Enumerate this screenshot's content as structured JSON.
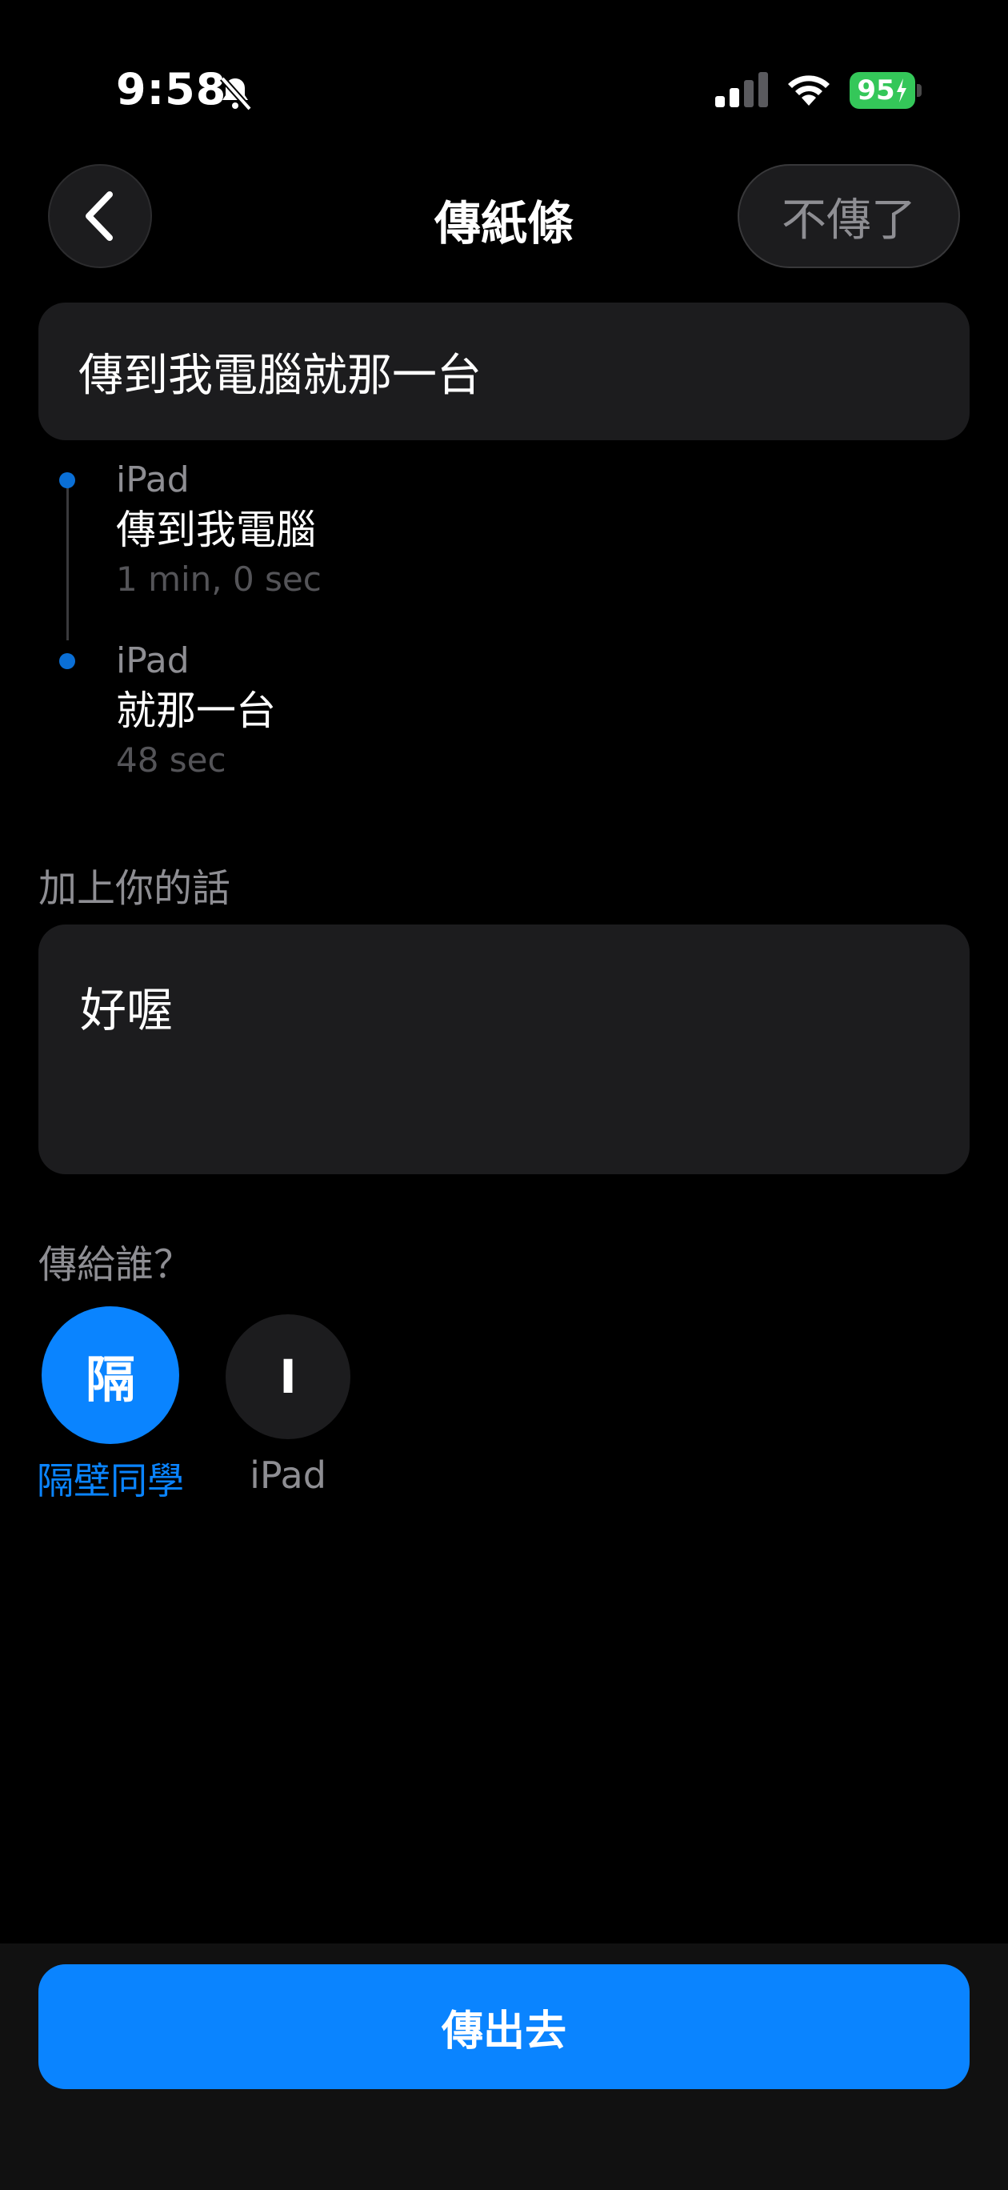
{
  "status_bar": {
    "time": "9:58",
    "battery": "95",
    "icons": [
      "bell-slash-icon",
      "cellular-signal-icon",
      "wifi-icon",
      "battery-charging-icon"
    ]
  },
  "nav": {
    "back_icon": "chevron-left-icon",
    "title": "傳紙條",
    "cancel_label": "不傳了"
  },
  "message": {
    "text": "傳到我電腦就那一台"
  },
  "timeline": [
    {
      "source": "iPad",
      "text": "傳到我電腦",
      "duration": "1 min, 0 sec"
    },
    {
      "source": "iPad",
      "text": "就那一台",
      "duration": "48 sec"
    }
  ],
  "note": {
    "label": "加上你的話",
    "value": "好喔"
  },
  "recipients": {
    "label": "傳給誰？",
    "items": [
      {
        "initial": "隔",
        "name": "隔壁同學",
        "selected": true
      },
      {
        "initial": "I",
        "name": "iPad",
        "selected": false
      }
    ]
  },
  "send_label": "傳出去",
  "colors": {
    "accent": "#0a84ff",
    "card": "#1c1c1e",
    "battery": "#34c759",
    "secondary_text": "#8e8e93"
  }
}
